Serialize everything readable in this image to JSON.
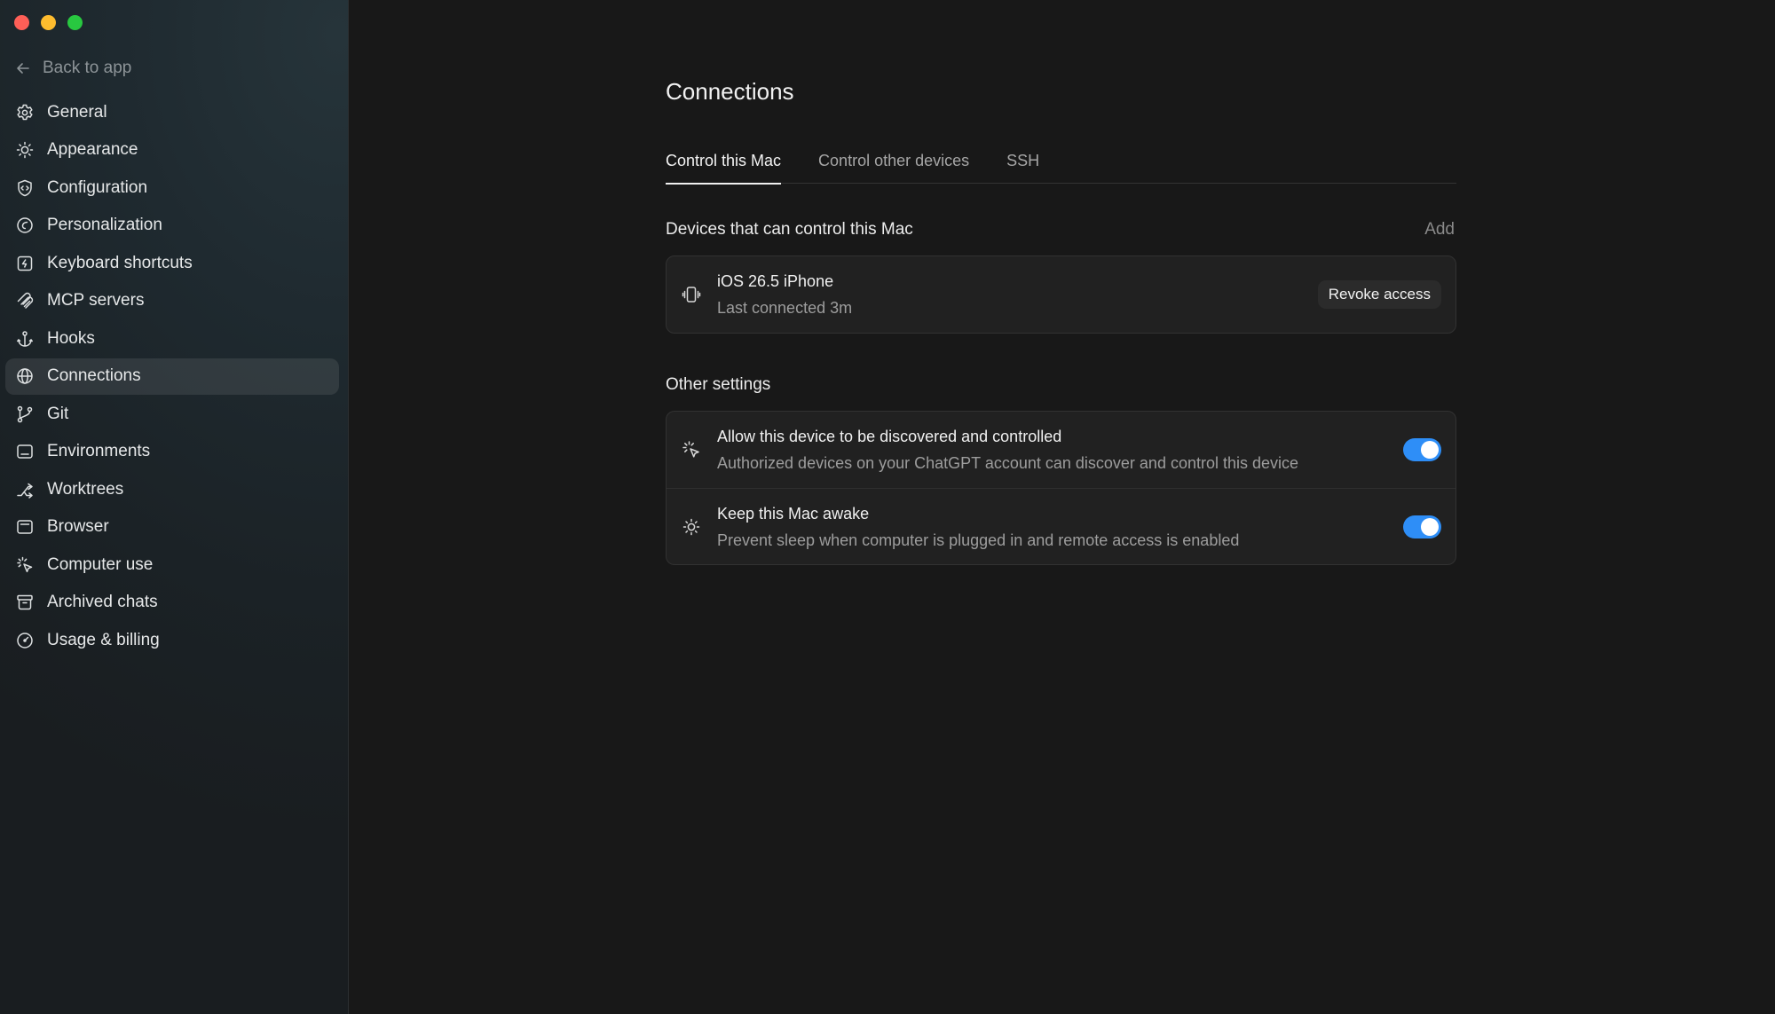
{
  "sidebar": {
    "back_label": "Back to app",
    "items": [
      {
        "label": "General",
        "icon": "gear-icon"
      },
      {
        "label": "Appearance",
        "icon": "sun-icon"
      },
      {
        "label": "Configuration",
        "icon": "shield-code-icon"
      },
      {
        "label": "Personalization",
        "icon": "personalization-icon"
      },
      {
        "label": "Keyboard shortcuts",
        "icon": "keyboard-bolt-icon"
      },
      {
        "label": "MCP servers",
        "icon": "mcp-icon"
      },
      {
        "label": "Hooks",
        "icon": "anchor-icon"
      },
      {
        "label": "Connections",
        "icon": "globe-icon",
        "active": true
      },
      {
        "label": "Git",
        "icon": "git-branch-icon"
      },
      {
        "label": "Environments",
        "icon": "environment-icon"
      },
      {
        "label": "Worktrees",
        "icon": "worktree-icon"
      },
      {
        "label": "Browser",
        "icon": "browser-icon"
      },
      {
        "label": "Computer use",
        "icon": "cursor-click-icon"
      },
      {
        "label": "Archived chats",
        "icon": "archive-icon"
      },
      {
        "label": "Usage & billing",
        "icon": "gauge-icon"
      }
    ]
  },
  "main": {
    "title": "Connections",
    "tabs": [
      {
        "label": "Control this Mac",
        "active": true
      },
      {
        "label": "Control other devices"
      },
      {
        "label": "SSH"
      }
    ],
    "devices_section": {
      "title": "Devices that can control this Mac",
      "add_label": "Add",
      "devices": [
        {
          "name": "iOS 26.5 iPhone",
          "status": "Last connected 3m",
          "action_label": "Revoke access",
          "icon": "phone-vibrate-icon"
        }
      ]
    },
    "other_section": {
      "title": "Other settings",
      "settings": [
        {
          "title": "Allow this device to be discovered and controlled",
          "description": "Authorized devices on your ChatGPT account can discover and control this device",
          "enabled": true,
          "icon": "cursor-click-icon"
        },
        {
          "title": "Keep this Mac awake",
          "description": "Prevent sleep when computer is plugged in and remote access is enabled",
          "enabled": true,
          "icon": "sun-icon"
        }
      ]
    }
  },
  "colors": {
    "accent": "#2e8ef7",
    "background": "#181818",
    "card": "#212121"
  }
}
